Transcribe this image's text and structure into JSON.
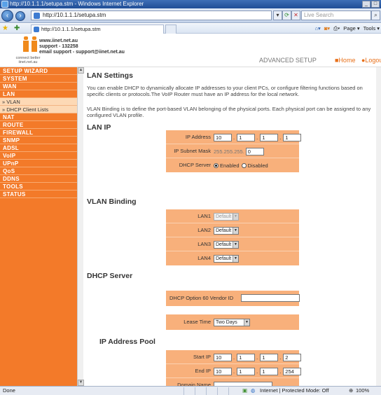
{
  "window": {
    "title": "http://10.1.1.1/setupa.stm - Windows Internet Explorer"
  },
  "browser": {
    "url": "http://10.1.1.1/setupa.stm",
    "search_placeholder": "Live Search",
    "tab_title": "http://10.1.1.1/setupa.stm",
    "commands": [
      "Page ▾",
      "Tools ▾"
    ]
  },
  "header": {
    "logo_tagline": "connect better",
    "logo_site": "iinet.net.au",
    "contact_lines": [
      "www.iinet.net.au",
      "support - 132258",
      "email support - support@iinet.net.au"
    ],
    "section_title": "ADVANCED SETUP",
    "links": [
      "■Home",
      "●Logout"
    ]
  },
  "sidebar": {
    "items": [
      {
        "label": "SETUP WIZARD",
        "type": "main"
      },
      {
        "label": "SYSTEM",
        "type": "main"
      },
      {
        "label": "WAN",
        "type": "main"
      },
      {
        "label": "LAN",
        "type": "main"
      },
      {
        "label": "» VLAN",
        "type": "sub"
      },
      {
        "label": "» DHCP Client Lists",
        "type": "sub"
      },
      {
        "label": "NAT",
        "type": "main"
      },
      {
        "label": "ROUTE",
        "type": "main"
      },
      {
        "label": "FIREWALL",
        "type": "main"
      },
      {
        "label": "SNMP",
        "type": "main"
      },
      {
        "label": "ADSL",
        "type": "main"
      },
      {
        "label": "VoIP",
        "type": "main"
      },
      {
        "label": "UPnP",
        "type": "main"
      },
      {
        "label": "QoS",
        "type": "main"
      },
      {
        "label": "DDNS",
        "type": "main"
      },
      {
        "label": "TOOLS",
        "type": "main"
      },
      {
        "label": "STATUS",
        "type": "main"
      }
    ]
  },
  "main": {
    "title": "LAN Settings",
    "desc1": "You can enable DHCP to dynamically allocate IP addresses to your client PCs, or configure filtering functions based on specific clients or protocols.The VoIP Router must have an IP address for the local network.",
    "desc2": "VLAN Binding is to define the port-based VLAN belonging of the physical ports. Each physical port can be assigned to any configured VLAN profile.",
    "lan_ip": {
      "heading": "LAN IP",
      "ip_label": "IP Address",
      "ip": [
        "10",
        "1",
        "1",
        "1"
      ],
      "mask_label": "IP Subnet Mask",
      "mask_prefix": "255.255.255.",
      "mask_last": "0",
      "dhcp_label": "DHCP Server",
      "enabled_label": "Enabled",
      "disabled_label": "Disabled"
    },
    "vlan": {
      "heading": "VLAN Binding",
      "rows": [
        {
          "label": "LAN1",
          "value": "Default",
          "disabled": true
        },
        {
          "label": "LAN2",
          "value": "Default",
          "disabled": false
        },
        {
          "label": "LAN3",
          "value": "Default",
          "disabled": false
        },
        {
          "label": "LAN4",
          "value": "Default",
          "disabled": false
        }
      ]
    },
    "dhcp": {
      "heading": "DHCP Server",
      "vendor_label": "DHCP Option 60 Vendor ID",
      "vendor_value": "",
      "lease_label": "Lease Time",
      "lease_value": "Two Days"
    },
    "pool": {
      "heading": "IP Address Pool",
      "start_label": "Start IP",
      "start": [
        "10",
        "1",
        "1",
        "2"
      ],
      "end_label": "End IP",
      "end": [
        "10",
        "1",
        "1",
        "254"
      ],
      "domain_label": "Domain Name"
    }
  },
  "statusbar": {
    "left": "Done",
    "zone": "Internet | Protected Mode: Off",
    "zoom": "100%"
  }
}
